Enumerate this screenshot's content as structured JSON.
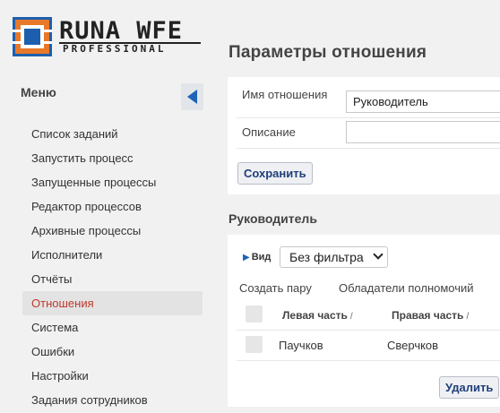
{
  "logo": {
    "title": "RUNA WFE",
    "subtitle": "PROFESSIONAL"
  },
  "sidebar": {
    "title": "Меню",
    "items": [
      {
        "label": "Список заданий"
      },
      {
        "label": "Запустить процесс"
      },
      {
        "label": "Запущенные процессы"
      },
      {
        "label": "Редактор процессов"
      },
      {
        "label": "Архивные процессы"
      },
      {
        "label": "Исполнители"
      },
      {
        "label": "Отчёты"
      },
      {
        "label": "Отношения",
        "active": true
      },
      {
        "label": "Система"
      },
      {
        "label": "Ошибки"
      },
      {
        "label": "Настройки"
      },
      {
        "label": "Задания сотрудников"
      }
    ]
  },
  "page": {
    "title": "Параметры отношения"
  },
  "form": {
    "name_label": "Имя отношения",
    "name_value": "Руководитель",
    "description_label": "Описание",
    "description_value": "",
    "save_label": "Сохранить"
  },
  "relation": {
    "title": "Руководитель",
    "view_label": "Вид",
    "filter_value": "Без фильтра",
    "create_pair_label": "Создать пару",
    "holders_label": "Обладатели полномочий",
    "columns": [
      {
        "label": "Левая часть",
        "sort": "/"
      },
      {
        "label": "Правая часть",
        "sort": "/"
      }
    ],
    "rows": [
      {
        "left": "Паучков",
        "right": "Сверчков"
      }
    ],
    "delete_label": "Удалить"
  },
  "colors": {
    "accent": "#1d63b8",
    "active_nav": "#c0392b",
    "button_text": "#1f3f7a"
  }
}
